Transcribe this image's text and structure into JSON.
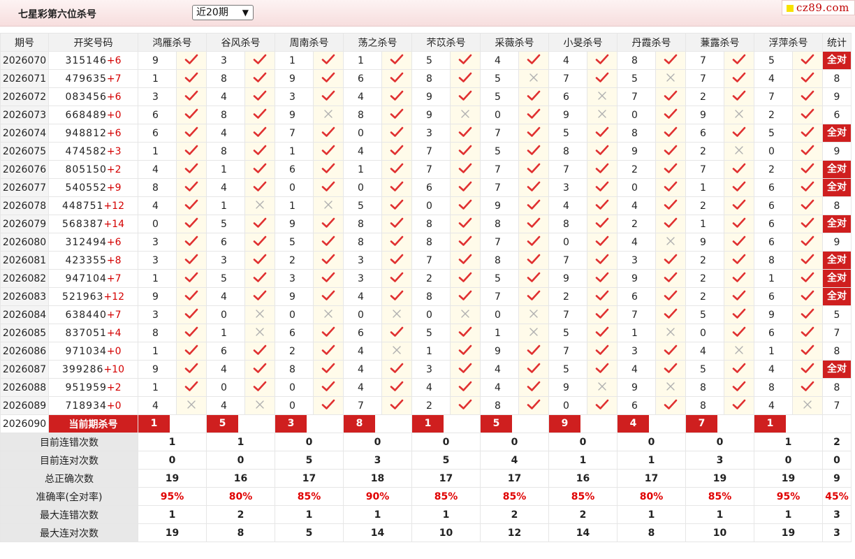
{
  "header": {
    "title": "七星彩第六位杀号",
    "period_select": "近20期",
    "logo_text": "cz89.com"
  },
  "table": {
    "col_headers": [
      "期号",
      "开奖号码",
      "鸿雁杀号",
      "谷风杀号",
      "周南杀号",
      "荡之杀号",
      "芣苡杀号",
      "采薇杀号",
      "小旻杀号",
      "丹霞杀号",
      "蒹露杀号",
      "浮萍杀号",
      "统计"
    ],
    "quan_dui_label": "全对",
    "rows": [
      {
        "issue": "2026070",
        "digits": "315146",
        "extra": "+6",
        "kills": [
          [
            9,
            1
          ],
          [
            3,
            1
          ],
          [
            1,
            1
          ],
          [
            1,
            1
          ],
          [
            5,
            1
          ],
          [
            4,
            1
          ],
          [
            4,
            1
          ],
          [
            8,
            1
          ],
          [
            7,
            1
          ],
          [
            5,
            1
          ]
        ],
        "stat": "全对"
      },
      {
        "issue": "2026071",
        "digits": "479635",
        "extra": "+7",
        "kills": [
          [
            1,
            1
          ],
          [
            8,
            1
          ],
          [
            9,
            1
          ],
          [
            6,
            1
          ],
          [
            8,
            1
          ],
          [
            5,
            0
          ],
          [
            7,
            1
          ],
          [
            5,
            0
          ],
          [
            7,
            1
          ],
          [
            4,
            1
          ]
        ],
        "stat": "8"
      },
      {
        "issue": "2026072",
        "digits": "083456",
        "extra": "+6",
        "kills": [
          [
            3,
            1
          ],
          [
            4,
            1
          ],
          [
            3,
            1
          ],
          [
            4,
            1
          ],
          [
            9,
            1
          ],
          [
            5,
            1
          ],
          [
            6,
            0
          ],
          [
            7,
            1
          ],
          [
            2,
            1
          ],
          [
            7,
            1
          ]
        ],
        "stat": "9"
      },
      {
        "issue": "2026073",
        "digits": "668489",
        "extra": "+0",
        "kills": [
          [
            6,
            1
          ],
          [
            8,
            1
          ],
          [
            9,
            0
          ],
          [
            8,
            1
          ],
          [
            9,
            0
          ],
          [
            0,
            1
          ],
          [
            9,
            0
          ],
          [
            0,
            1
          ],
          [
            9,
            0
          ],
          [
            2,
            1
          ]
        ],
        "stat": "6"
      },
      {
        "issue": "2026074",
        "digits": "948812",
        "extra": "+6",
        "kills": [
          [
            6,
            1
          ],
          [
            4,
            1
          ],
          [
            7,
            1
          ],
          [
            0,
            1
          ],
          [
            3,
            1
          ],
          [
            7,
            1
          ],
          [
            5,
            1
          ],
          [
            8,
            1
          ],
          [
            6,
            1
          ],
          [
            5,
            1
          ]
        ],
        "stat": "全对"
      },
      {
        "issue": "2026075",
        "digits": "474582",
        "extra": "+3",
        "kills": [
          [
            1,
            1
          ],
          [
            8,
            1
          ],
          [
            1,
            1
          ],
          [
            4,
            1
          ],
          [
            7,
            1
          ],
          [
            5,
            1
          ],
          [
            8,
            1
          ],
          [
            9,
            1
          ],
          [
            2,
            0
          ],
          [
            0,
            1
          ]
        ],
        "stat": "9"
      },
      {
        "issue": "2026076",
        "digits": "805150",
        "extra": "+2",
        "kills": [
          [
            4,
            1
          ],
          [
            1,
            1
          ],
          [
            6,
            1
          ],
          [
            1,
            1
          ],
          [
            7,
            1
          ],
          [
            7,
            1
          ],
          [
            7,
            1
          ],
          [
            2,
            1
          ],
          [
            7,
            1
          ],
          [
            2,
            1
          ]
        ],
        "stat": "全对"
      },
      {
        "issue": "2026077",
        "digits": "540552",
        "extra": "+9",
        "kills": [
          [
            8,
            1
          ],
          [
            4,
            1
          ],
          [
            0,
            1
          ],
          [
            0,
            1
          ],
          [
            6,
            1
          ],
          [
            7,
            1
          ],
          [
            3,
            1
          ],
          [
            0,
            1
          ],
          [
            1,
            1
          ],
          [
            6,
            1
          ]
        ],
        "stat": "全对"
      },
      {
        "issue": "2026078",
        "digits": "448751",
        "extra": "+12",
        "kills": [
          [
            4,
            1
          ],
          [
            1,
            0
          ],
          [
            1,
            0
          ],
          [
            5,
            1
          ],
          [
            0,
            1
          ],
          [
            9,
            1
          ],
          [
            4,
            1
          ],
          [
            4,
            1
          ],
          [
            2,
            1
          ],
          [
            6,
            1
          ]
        ],
        "stat": "8"
      },
      {
        "issue": "2026079",
        "digits": "568387",
        "extra": "+14",
        "kills": [
          [
            0,
            1
          ],
          [
            5,
            1
          ],
          [
            9,
            1
          ],
          [
            8,
            1
          ],
          [
            8,
            1
          ],
          [
            8,
            1
          ],
          [
            8,
            1
          ],
          [
            2,
            1
          ],
          [
            1,
            1
          ],
          [
            6,
            1
          ]
        ],
        "stat": "全对"
      },
      {
        "issue": "2026080",
        "digits": "312494",
        "extra": "+6",
        "kills": [
          [
            3,
            1
          ],
          [
            6,
            1
          ],
          [
            5,
            1
          ],
          [
            8,
            1
          ],
          [
            8,
            1
          ],
          [
            7,
            1
          ],
          [
            0,
            1
          ],
          [
            4,
            0
          ],
          [
            9,
            1
          ],
          [
            6,
            1
          ]
        ],
        "stat": "9"
      },
      {
        "issue": "2026081",
        "digits": "423355",
        "extra": "+8",
        "kills": [
          [
            3,
            1
          ],
          [
            3,
            1
          ],
          [
            2,
            1
          ],
          [
            3,
            1
          ],
          [
            7,
            1
          ],
          [
            8,
            1
          ],
          [
            7,
            1
          ],
          [
            3,
            1
          ],
          [
            2,
            1
          ],
          [
            8,
            1
          ]
        ],
        "stat": "全对"
      },
      {
        "issue": "2026082",
        "digits": "947104",
        "extra": "+7",
        "kills": [
          [
            1,
            1
          ],
          [
            5,
            1
          ],
          [
            3,
            1
          ],
          [
            3,
            1
          ],
          [
            2,
            1
          ],
          [
            5,
            1
          ],
          [
            9,
            1
          ],
          [
            9,
            1
          ],
          [
            2,
            1
          ],
          [
            1,
            1
          ]
        ],
        "stat": "全对"
      },
      {
        "issue": "2026083",
        "digits": "521963",
        "extra": "+12",
        "kills": [
          [
            9,
            1
          ],
          [
            4,
            1
          ],
          [
            9,
            1
          ],
          [
            4,
            1
          ],
          [
            8,
            1
          ],
          [
            7,
            1
          ],
          [
            2,
            1
          ],
          [
            6,
            1
          ],
          [
            2,
            1
          ],
          [
            6,
            1
          ]
        ],
        "stat": "全对"
      },
      {
        "issue": "2026084",
        "digits": "638440",
        "extra": "+7",
        "kills": [
          [
            3,
            1
          ],
          [
            0,
            0
          ],
          [
            0,
            0
          ],
          [
            0,
            0
          ],
          [
            0,
            0
          ],
          [
            0,
            0
          ],
          [
            7,
            1
          ],
          [
            7,
            1
          ],
          [
            5,
            1
          ],
          [
            9,
            1
          ]
        ],
        "stat": "5"
      },
      {
        "issue": "2026085",
        "digits": "837051",
        "extra": "+4",
        "kills": [
          [
            8,
            1
          ],
          [
            1,
            0
          ],
          [
            6,
            1
          ],
          [
            6,
            1
          ],
          [
            5,
            1
          ],
          [
            1,
            0
          ],
          [
            5,
            1
          ],
          [
            1,
            0
          ],
          [
            0,
            1
          ],
          [
            6,
            1
          ]
        ],
        "stat": "7"
      },
      {
        "issue": "2026086",
        "digits": "971034",
        "extra": "+0",
        "kills": [
          [
            1,
            1
          ],
          [
            6,
            1
          ],
          [
            2,
            1
          ],
          [
            4,
            0
          ],
          [
            1,
            1
          ],
          [
            9,
            1
          ],
          [
            7,
            1
          ],
          [
            3,
            1
          ],
          [
            4,
            0
          ],
          [
            1,
            1
          ]
        ],
        "stat": "8"
      },
      {
        "issue": "2026087",
        "digits": "399286",
        "extra": "+10",
        "kills": [
          [
            9,
            1
          ],
          [
            4,
            1
          ],
          [
            8,
            1
          ],
          [
            4,
            1
          ],
          [
            3,
            1
          ],
          [
            4,
            1
          ],
          [
            5,
            1
          ],
          [
            4,
            1
          ],
          [
            5,
            1
          ],
          [
            4,
            1
          ]
        ],
        "stat": "全对"
      },
      {
        "issue": "2026088",
        "digits": "951959",
        "extra": "+2",
        "kills": [
          [
            1,
            1
          ],
          [
            0,
            1
          ],
          [
            0,
            1
          ],
          [
            4,
            1
          ],
          [
            4,
            1
          ],
          [
            4,
            1
          ],
          [
            9,
            0
          ],
          [
            9,
            0
          ],
          [
            8,
            1
          ],
          [
            8,
            1
          ]
        ],
        "stat": "8"
      },
      {
        "issue": "2026089",
        "digits": "718934",
        "extra": "+0",
        "kills": [
          [
            4,
            0
          ],
          [
            4,
            0
          ],
          [
            0,
            1
          ],
          [
            7,
            1
          ],
          [
            2,
            1
          ],
          [
            8,
            1
          ],
          [
            0,
            1
          ],
          [
            6,
            1
          ],
          [
            8,
            1
          ],
          [
            4,
            0
          ]
        ],
        "stat": "7"
      }
    ],
    "current": {
      "issue": "2026090",
      "label": "当前期杀号",
      "kills": [
        1,
        5,
        3,
        8,
        1,
        5,
        9,
        4,
        7,
        1
      ]
    },
    "summary": [
      {
        "label": "目前连错次数",
        "values": [
          "1",
          "1",
          "0",
          "0",
          "0",
          "0",
          "0",
          "0",
          "0",
          "1",
          "2"
        ]
      },
      {
        "label": "目前连对次数",
        "values": [
          "0",
          "0",
          "5",
          "3",
          "5",
          "4",
          "1",
          "1",
          "3",
          "0",
          "0"
        ]
      },
      {
        "label": "总正确次数",
        "values": [
          "19",
          "16",
          "17",
          "18",
          "17",
          "17",
          "16",
          "17",
          "19",
          "19",
          "9"
        ]
      },
      {
        "label": "准确率(全对率)",
        "values": [
          "95%",
          "80%",
          "85%",
          "90%",
          "85%",
          "85%",
          "85%",
          "80%",
          "85%",
          "95%",
          "45%"
        ]
      },
      {
        "label": "最大连错次数",
        "values": [
          "1",
          "2",
          "1",
          "1",
          "1",
          "2",
          "2",
          "1",
          "1",
          "1",
          "3"
        ]
      },
      {
        "label": "最大连对次数",
        "values": [
          "19",
          "8",
          "5",
          "14",
          "10",
          "12",
          "14",
          "8",
          "10",
          "19",
          "3"
        ]
      }
    ]
  },
  "colors": {
    "accent_red": "#cf1f1f",
    "check": "#e03030",
    "cross": "#b0b0b0",
    "stat_blue": "#1010c8",
    "rate_red": "#e00000"
  }
}
